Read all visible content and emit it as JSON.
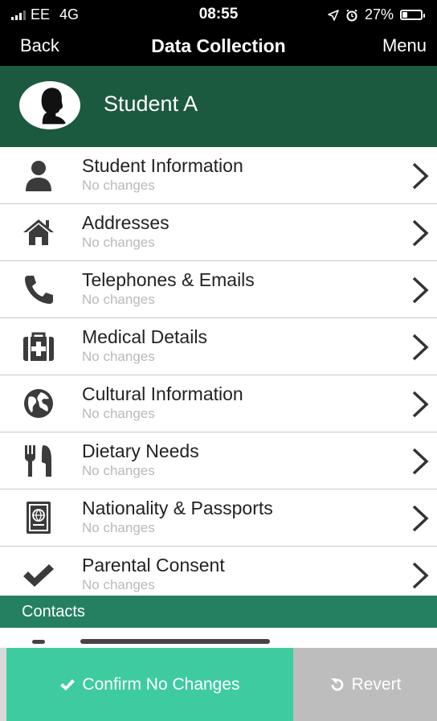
{
  "status_bar": {
    "carrier": "EE",
    "network": "4G",
    "time": "08:55",
    "battery": "27%",
    "battery_level": 0.27,
    "icons": [
      "signal-icon",
      "location-icon",
      "alarm-icon",
      "battery-icon"
    ]
  },
  "nav": {
    "back_label": "Back",
    "title": "Data Collection",
    "menu_label": "Menu"
  },
  "student": {
    "name": "Student A",
    "avatar_icon": "person-silhouette-icon"
  },
  "sections": [
    {
      "label": "Student Information",
      "status": "No changes",
      "icon": "person-icon"
    },
    {
      "label": "Addresses",
      "status": "No changes",
      "icon": "home-icon"
    },
    {
      "label": "Telephones & Emails",
      "status": "No changes",
      "icon": "phone-icon"
    },
    {
      "label": "Medical Details",
      "status": "No changes",
      "icon": "medical-kit-icon"
    },
    {
      "label": "Cultural Information",
      "status": "No changes",
      "icon": "globe-icon"
    },
    {
      "label": "Dietary Needs",
      "status": "No changes",
      "icon": "cutlery-icon"
    },
    {
      "label": "Nationality & Passports",
      "status": "No changes",
      "icon": "passport-icon"
    },
    {
      "label": "Parental Consent",
      "status": "No changes",
      "icon": "checkmark-icon"
    }
  ],
  "contacts": {
    "header": "Contacts"
  },
  "actions": {
    "confirm_label": "Confirm No Changes",
    "revert_label": "Revert"
  },
  "colors": {
    "header_green": "#1b5a3f",
    "contacts_green": "#248061",
    "confirm_green": "#3ecba0",
    "revert_grey": "#bdbdbd"
  }
}
